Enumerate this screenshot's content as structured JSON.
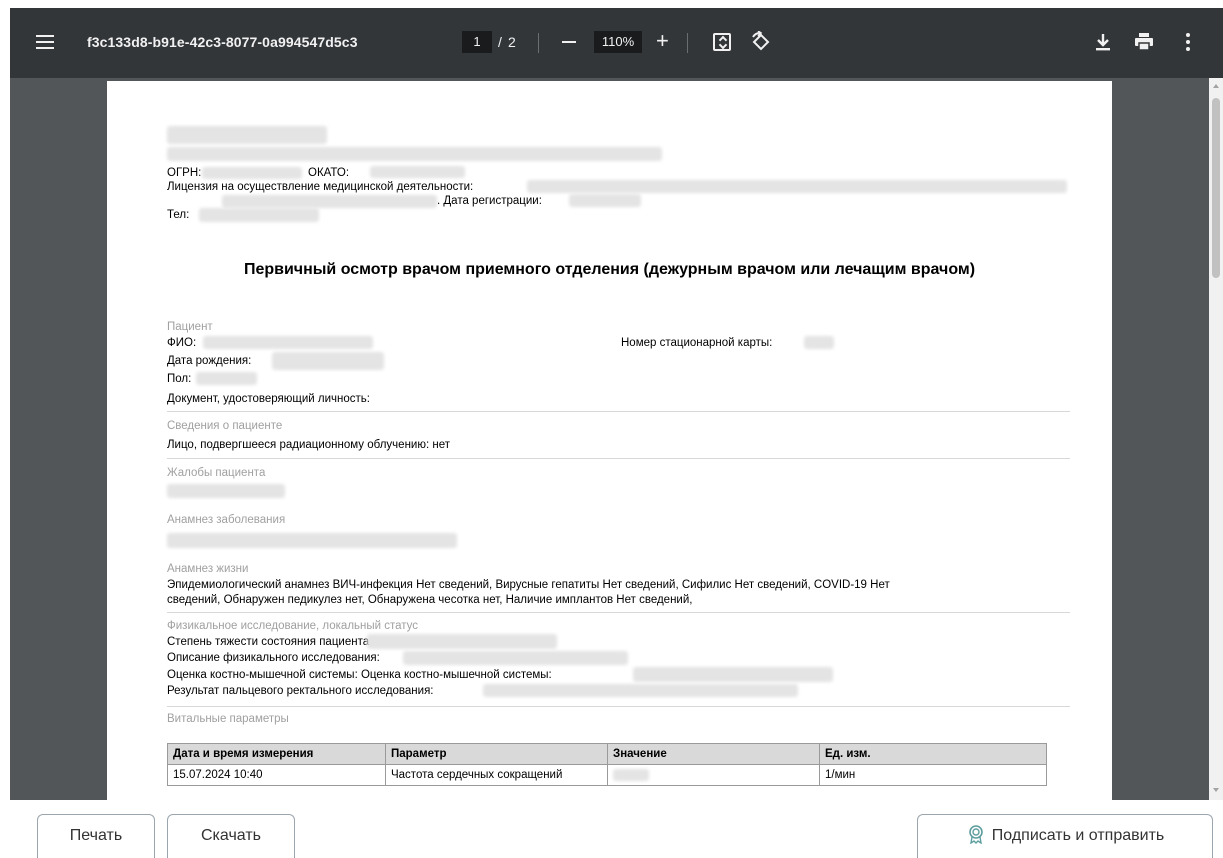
{
  "toolbar": {
    "title": "f3c133d8-b91e-42c3-8077-0a994547d5c3",
    "page_current": "1",
    "page_separator": "/",
    "page_total": "2",
    "zoom": "110%",
    "icons": [
      "menu-icon",
      "zoom-out-icon",
      "zoom-in-icon",
      "fit-page-icon",
      "rotate-icon",
      "download-icon",
      "print-icon",
      "more-options-icon"
    ]
  },
  "document": {
    "ogrn_label": "ОГРН:",
    "okato_label": "ОКАТО:",
    "license_label": "Лицензия на осуществление медицинской деятельности:",
    "reg_date_label": ". Дата регистрации:",
    "phone_label": "Тел:",
    "title": "Первичный осмотр врачом приемного отделения (дежурным врачом или лечащим врачом)",
    "patient_section": "Пациент",
    "fio_label": "ФИО:",
    "card_number_label": "Номер стационарной карты:",
    "birth_date_label": "Дата рождения:",
    "sex_label": "Пол:",
    "id_document_label": "Документ, удостоверяющий личность:",
    "patient_info_section": "Сведения о пациенте",
    "radiation_text": "Лицо, подвергшееся радиационному облучению: нет",
    "complaints_section": "Жалобы пациента",
    "disease_anamnesis_section": "Анамнез заболевания",
    "life_anamnesis_section": "Анамнез жизни",
    "life_anamnesis_line1": "Эпидемиологический анамнез ВИЧ-инфекция Нет сведений, Вирусные гепатиты Нет сведений, Сифилис Нет сведений, COVID-19 Нет",
    "life_anamnesis_line2": "сведений, Обнаружен педикулез нет, Обнаружена чесотка нет, Наличие имплантов Нет сведений,",
    "physical_section": "Физикальное исследование, локальный статус",
    "severity_label": "Степень тяжести состояния пациента:",
    "physical_desc_label": "Описание физикального исследования:",
    "musculo_label": "Оценка костно-мышечной системы: Оценка костно-мышечной системы:",
    "rectal_label": "Результат пальцевого ректального исследования:",
    "vitals_section": "Витальные параметры",
    "vitals_table": {
      "headers": [
        "Дата и время измерения",
        "Параметр",
        "Значение",
        "Ед. изм."
      ],
      "rows": [
        [
          "15.07.2024 10:40",
          "Частота сердечных сокращений",
          "",
          "1/мин"
        ]
      ]
    }
  },
  "actions": {
    "print_label": "Печать",
    "download_label": "Скачать",
    "sign_label": "Подписать и отправить"
  }
}
